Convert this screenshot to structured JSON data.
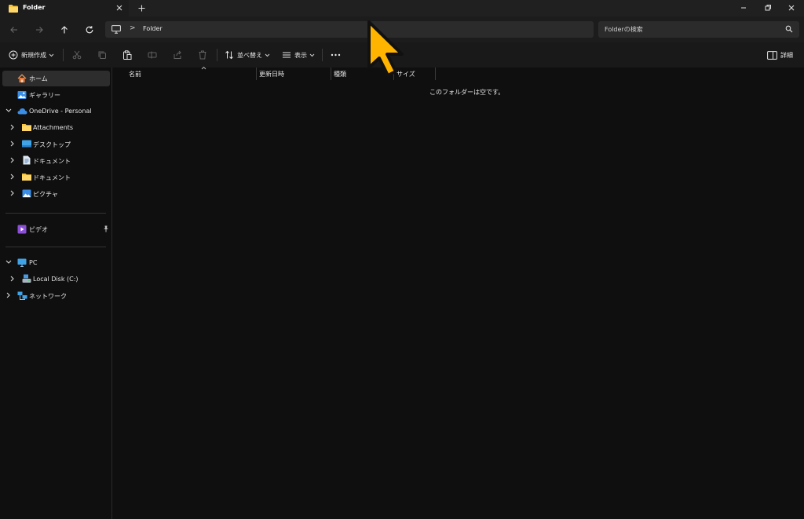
{
  "tab": {
    "title": "Folder"
  },
  "address": {
    "crumb_separator": ">",
    "crumb": "Folder"
  },
  "search": {
    "placeholder": "Folderの検索"
  },
  "commands": {
    "new": "新規作成",
    "sort": "並べ替え",
    "view": "表示",
    "details": "詳細"
  },
  "sidebar": {
    "home": "ホーム",
    "gallery": "ギャラリー",
    "onedrive": "OneDrive - Personal",
    "onedrive_children": [
      "Attachments",
      "デスクトップ",
      "ドキュメント",
      "ドキュメント",
      "ピクチャ"
    ],
    "pinned_video": "ビデオ",
    "pc": "PC",
    "local_disk": "Local Disk (C:)",
    "network": "ネットワーク"
  },
  "columns": [
    "名前",
    "更新日時",
    "種類",
    "サイズ"
  ],
  "empty_message": "このフォルダーは空です。",
  "colors": {
    "accent_folder": "#f8c43a",
    "onedrive_blue": "#3a8ee6",
    "cursor": "#ffb400"
  }
}
